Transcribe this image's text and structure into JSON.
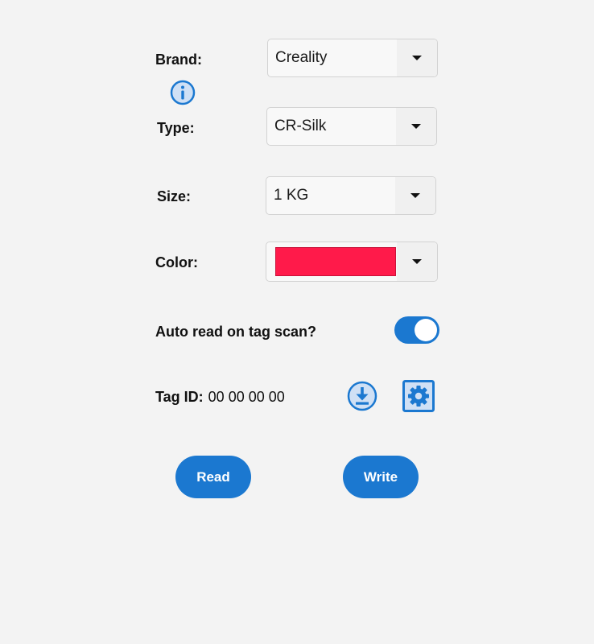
{
  "form": {
    "brand": {
      "label": "Brand:",
      "value": "Creality"
    },
    "type": {
      "label": "Type:",
      "value": "CR-Silk"
    },
    "size": {
      "label": "Size:",
      "value": "1 KG"
    },
    "color": {
      "label": "Color:",
      "swatch_hex": "#ff1a4a"
    }
  },
  "auto_read": {
    "label": "Auto read on tag scan?",
    "enabled": true
  },
  "tag": {
    "label": "Tag ID:",
    "value": "00 00 00 00"
  },
  "icons": {
    "info": "info-circle-icon",
    "download": "download-icon",
    "settings": "gear-icon",
    "dropdown": "caret-down-icon"
  },
  "actions": {
    "read_label": "Read",
    "write_label": "Write"
  },
  "colors": {
    "accent": "#1b78d0",
    "background": "#f3f3f3"
  }
}
